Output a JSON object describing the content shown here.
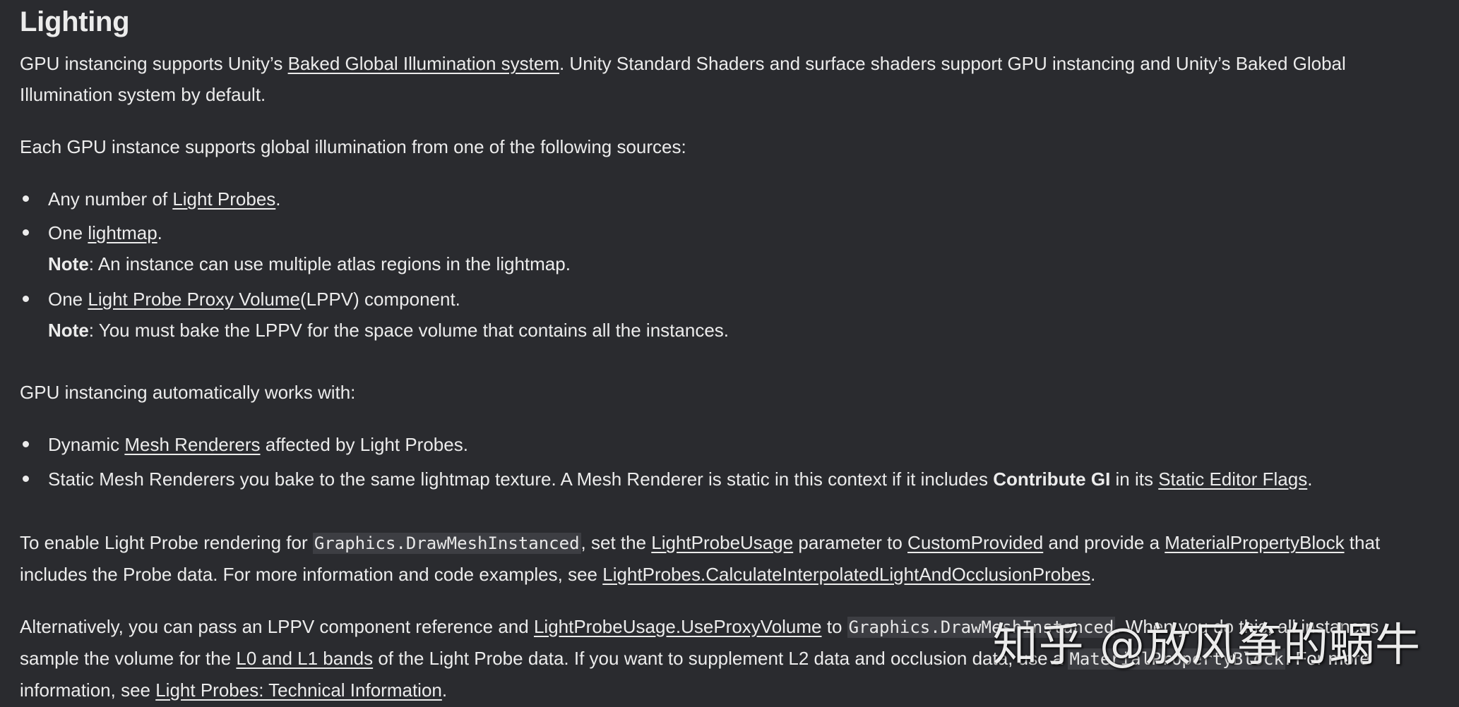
{
  "heading": "Lighting",
  "p1": {
    "t1": "GPU instancing supports Unity’s ",
    "link1": "Baked Global Illumination system",
    "t2": ". Unity Standard Shaders and surface shaders support GPU instancing and Unity’s Baked Global Illumination system by default."
  },
  "p2": "Each GPU instance supports global illumination from one of the following sources:",
  "list1": {
    "i1": {
      "t1": "Any number of ",
      "link": "Light Probes",
      "t2": "."
    },
    "i2": {
      "t1": "One ",
      "link": "lightmap",
      "t2": ".",
      "note_label": "Note",
      "note_text": ": An instance can use multiple atlas regions in the lightmap."
    },
    "i3": {
      "t1": "One ",
      "link": "Light Probe Proxy Volume",
      "t2": "(LPPV) component.",
      "note_label": "Note",
      "note_text": ": You must bake the LPPV for the space volume that contains all the instances."
    }
  },
  "p3": "GPU instancing automatically works with:",
  "list2": {
    "i1": {
      "t1": "Dynamic ",
      "link": "Mesh Renderers",
      "t2": " affected by Light Probes."
    },
    "i2": {
      "t1": "Static Mesh Renderers you bake to the same lightmap texture. A Mesh Renderer is static in this context if it includes ",
      "bold": "Contribute GI",
      "t2": " in its ",
      "link": "Static Editor Flags",
      "t3": "."
    }
  },
  "p4": {
    "t1": "To enable Light Probe rendering for ",
    "code1": "Graphics.DrawMeshInstanced",
    "t2": ", set the ",
    "link1": "LightProbeUsage",
    "t3": " parameter to ",
    "link2": "CustomProvided",
    "t4": " and provide a ",
    "link3": "MaterialPropertyBlock",
    "t5": " that includes the Probe data. For more information and code examples, see ",
    "link4": "LightProbes.CalculateInterpolatedLightAndOcclusionProbes",
    "t6": "."
  },
  "p5": {
    "t1": "Alternatively, you can pass an LPPV component reference and ",
    "link1": "LightProbeUsage.UseProxyVolume",
    "t2": " to ",
    "code1": "Graphics.DrawMeshInstanced",
    "t3": ". When you do this, all instances sample the volume for the ",
    "link2": "L0 and L1 bands",
    "t4": " of the Light Probe data. If you want to supplement L2 data and occlusion data, use a ",
    "code2": "MaterialPropertyBlock",
    "t5": ". For more information, see ",
    "link3": "Light Probes: Technical Information",
    "t6": "."
  },
  "watermark": "知乎 @放风筝的蜗牛"
}
